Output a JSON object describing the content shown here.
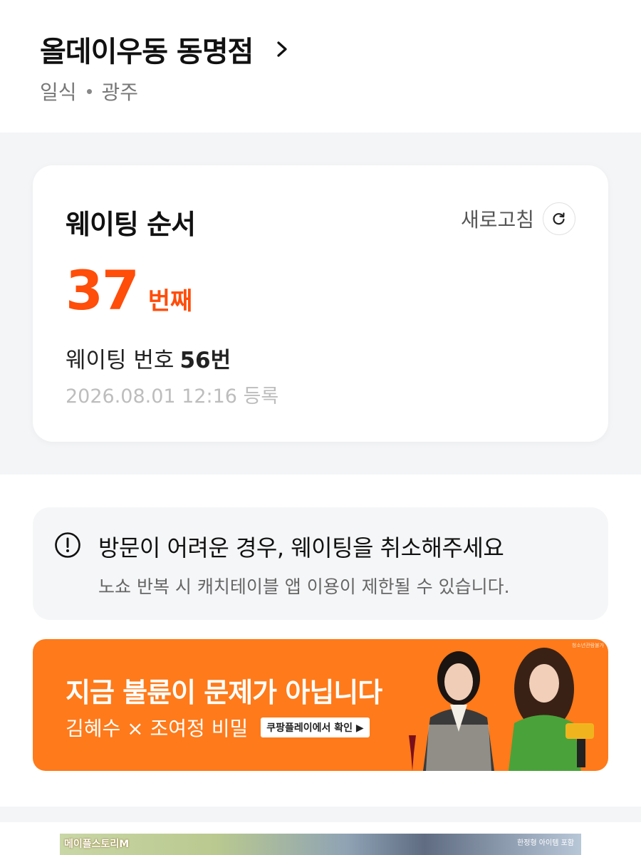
{
  "store": {
    "name": "올데이우동 동명점",
    "category": "일식",
    "region": "광주"
  },
  "waiting_card": {
    "title": "웨이팅 순서",
    "refresh_label": "새로고침",
    "position": "37",
    "position_unit": "번째",
    "number_label": "웨이팅 번호",
    "number_value": "56번",
    "registered": "2026.08.01 12:16 등록"
  },
  "notice": {
    "title": "방문이 어려운 경우, 웨이팅을 취소해주세요",
    "desc": "노쇼 반복 시 캐치테이블 앱 이용이 제한될 수 있습니다."
  },
  "banner": {
    "headline": "지금 불륜이 문제가 아닙니다",
    "sub": "김혜수 × 조여정 비밀",
    "cta": "쿠팡플레이에서 확인 ▶",
    "rating": "청소년관람불가"
  },
  "ad2": {
    "left_text": "메이플스토리M",
    "right_text": "한정형 아이템 포함"
  },
  "colors": {
    "accent": "#ff4d0a",
    "banner": "#ff7a1a",
    "band": "#f4f5f7"
  }
}
